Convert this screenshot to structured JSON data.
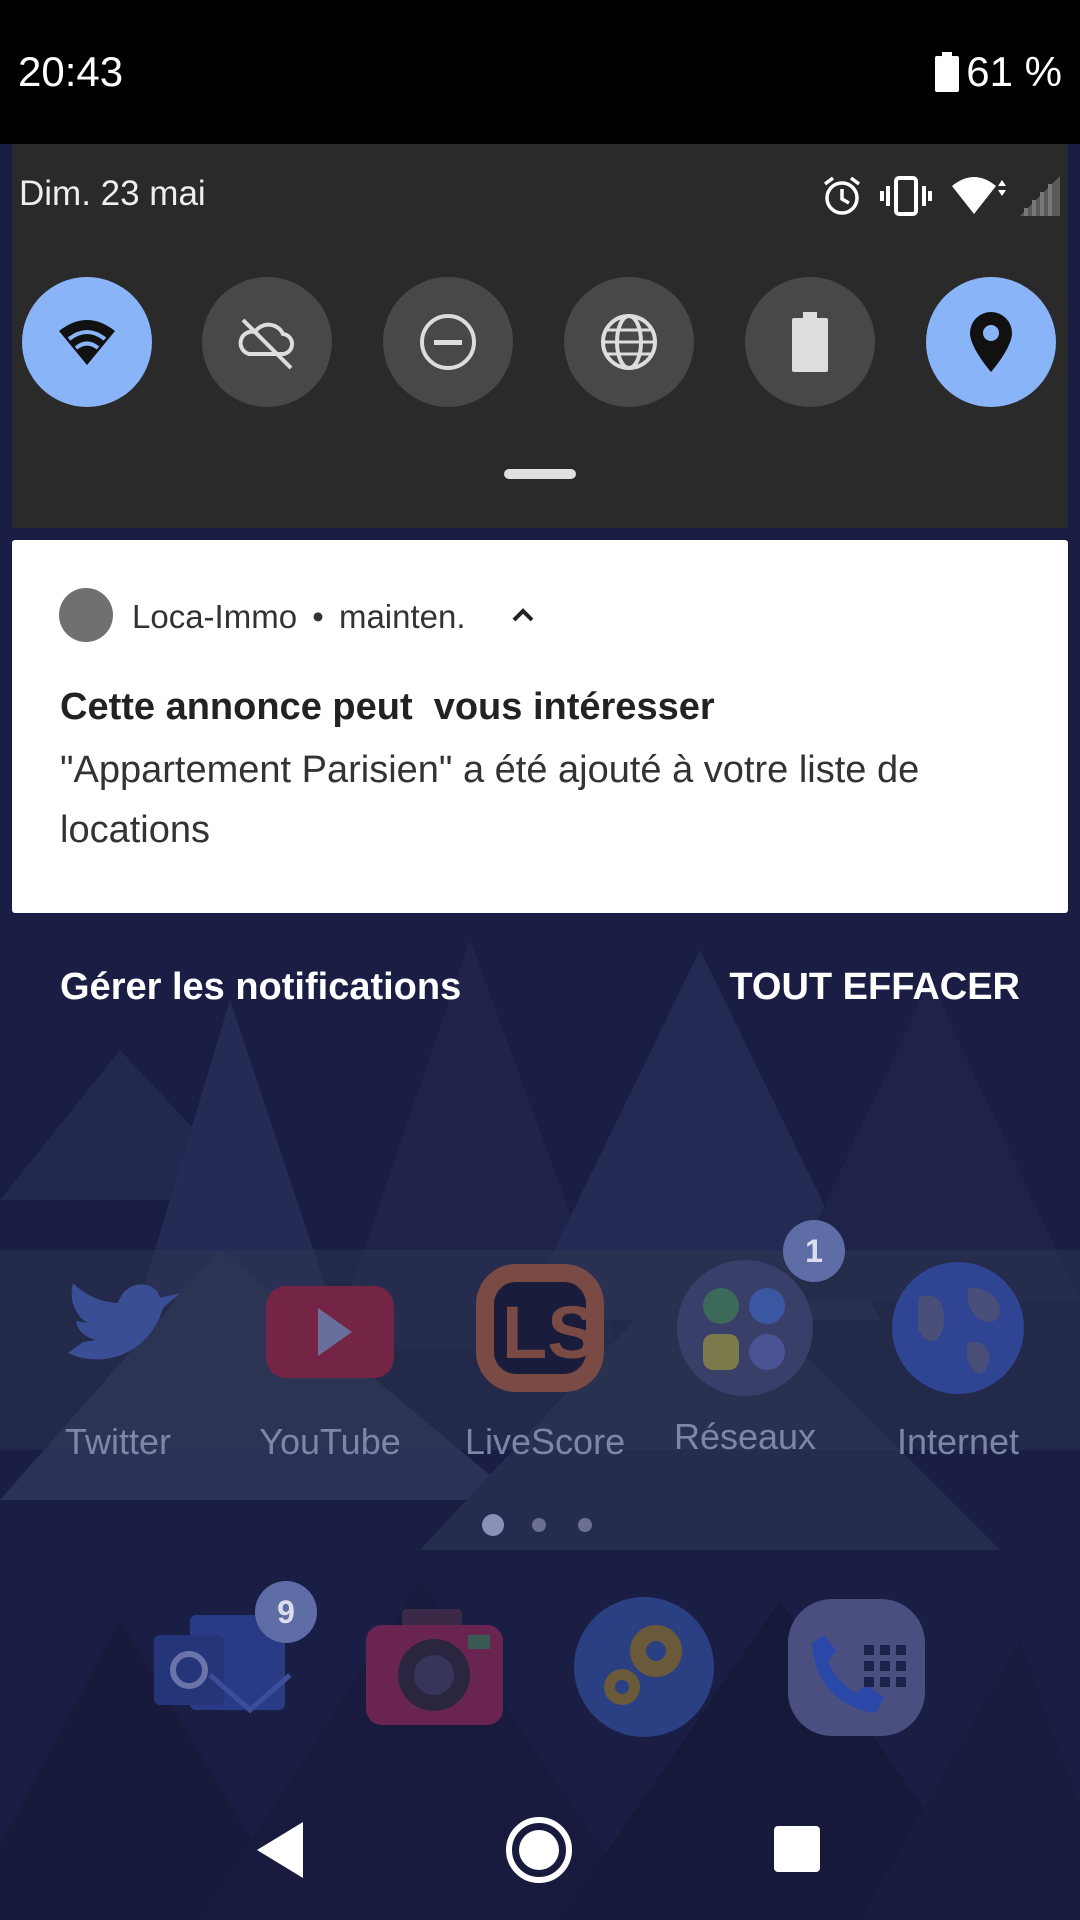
{
  "status_bar": {
    "time": "20:43",
    "battery_percent": "61 %",
    "battery_icon": "battery-icon"
  },
  "quick_settings": {
    "date": "Dim. 23 mai",
    "status_icons": [
      "alarm-icon",
      "vibrate-icon",
      "wifi-signal-icon",
      "cell-signal-icon"
    ],
    "tiles": [
      {
        "icon": "wifi-icon",
        "state": "on"
      },
      {
        "icon": "cloud-off-icon",
        "state": "off"
      },
      {
        "icon": "do-not-disturb-icon",
        "state": "off"
      },
      {
        "icon": "globe-icon",
        "state": "off"
      },
      {
        "icon": "battery-saver-icon",
        "state": "off"
      },
      {
        "icon": "location-icon",
        "state": "on"
      }
    ]
  },
  "notification": {
    "app_name": "Loca-Immo",
    "separator": "•",
    "time": "mainten.",
    "title": "Cette annonce peut  vous intéresser",
    "text": "\"Appartement Parisien\" a été ajouté à votre liste de locations"
  },
  "notification_actions": {
    "manage": "Gérer les notifications",
    "clear_all": "TOUT EFFACER"
  },
  "home_apps": [
    {
      "label": "Twitter",
      "icon": "twitter-icon"
    },
    {
      "label": "YouTube",
      "icon": "youtube-icon"
    },
    {
      "label": "LiveScore",
      "icon": "livescore-icon"
    },
    {
      "label": "Réseaux",
      "icon": "folder-icon",
      "badge": "1"
    },
    {
      "label": "Internet",
      "icon": "globe-icon"
    }
  ],
  "page_indicator": {
    "pages": 3,
    "current": 1
  },
  "dock": [
    {
      "icon": "outlook-icon",
      "badge": "9"
    },
    {
      "icon": "camera-icon"
    },
    {
      "icon": "settings-icon"
    },
    {
      "icon": "phone-icon"
    }
  ],
  "nav_bar": [
    "back-icon",
    "home-icon",
    "recents-icon"
  ],
  "colors": {
    "tile_on": "#8ab4f8",
    "tile_off": "#484848",
    "panel": "#2a2a2a",
    "scrim": "#1c1f45"
  }
}
